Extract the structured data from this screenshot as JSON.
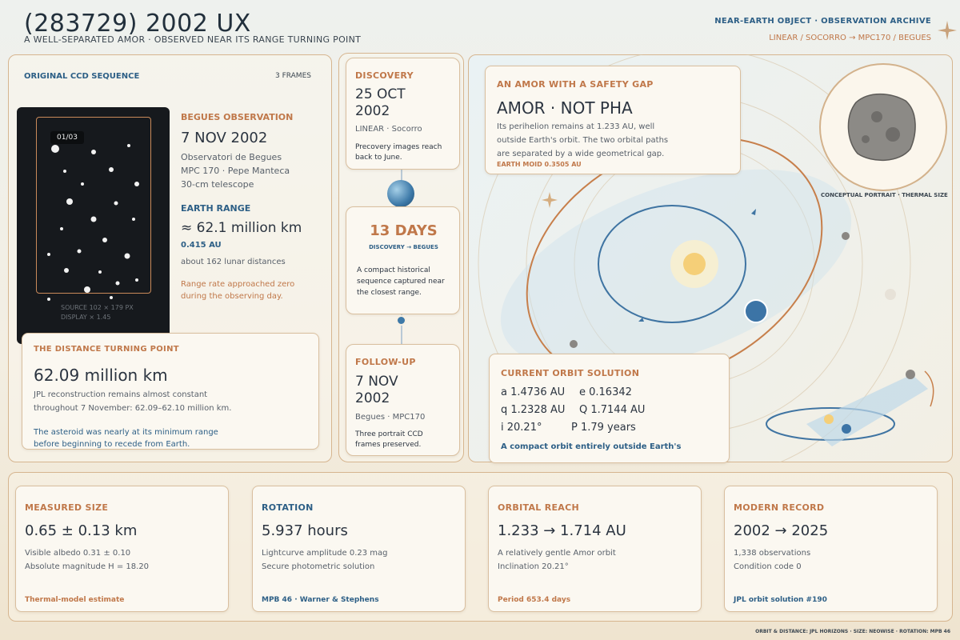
{
  "header": {
    "title": "(283729) 2002 UX",
    "subtitle": "A WELL-SEPARATED AMOR · OBSERVED NEAR ITS RANGE TURNING POINT",
    "archive": "NEAR-EARTH OBJECT · OBSERVATION ARCHIVE",
    "sources": "LINEAR / SOCORRO → MPC170 / BEGUES"
  },
  "ccd": {
    "title": "ORIGINAL CCD SEQUENCE",
    "frames": "3 FRAMES",
    "frame_badge": "01/03",
    "source_line": "SOURCE 102 × 179 PX",
    "display_line": "DISPLAY × 1.45"
  },
  "begues": {
    "kicker": "BEGUES OBSERVATION",
    "date": "7 NOV 2002",
    "line1": "Observatori de Begues",
    "line2": "MPC 170 · Pepe Manteca",
    "line3": "30-cm telescope",
    "range_kicker": "EARTH RANGE",
    "range": "≈ 62.1 million km",
    "range_au": "0.415 AU",
    "lunar": "about 162 lunar distances",
    "note": "Range rate approached zero during the observing day."
  },
  "turning": {
    "kicker": "THE DISTANCE TURNING POINT",
    "value": "62.09 million km",
    "desc": "JPL reconstruction remains almost constant throughout 7 November: 62.09–62.10 million km.",
    "note": "The asteroid was nearly at its minimum range before beginning to recede from Earth."
  },
  "discovery": {
    "kicker": "DISCOVERY",
    "date": "25 OCT 2002",
    "site": "LINEAR · Socorro",
    "note": "Precovery images reach back to June."
  },
  "interval": {
    "days": "13 DAYS",
    "span": "DISCOVERY → BEGUES",
    "note": "A compact historical sequence captured near the closest range."
  },
  "followup": {
    "kicker": "FOLLOW-UP",
    "date": "7 NOV 2002",
    "site": "Begues · MPC170",
    "note": "Three portrait CCD frames preserved."
  },
  "amor": {
    "kicker": "AN AMOR WITH A SAFETY GAP",
    "title": "AMOR · NOT PHA",
    "desc": "Its perihelion remains at 1.233 AU, well outside Earth's orbit. The two orbital paths are separated by a wide geometrical gap.",
    "moid": "EARTH MOID  0.3505 AU"
  },
  "portrait_caption": "CONCEPTUAL PORTRAIT · THERMAL SIZE",
  "orbit": {
    "kicker": "CURRENT ORBIT SOLUTION",
    "a": "a  1.4736 AU",
    "e": "e  0.16342",
    "q": "q  1.2328 AU",
    "Q": "Q  1.7144 AU",
    "i": "i  20.21°",
    "P": "P  1.79 years",
    "note": "A compact orbit entirely outside Earth's"
  },
  "cards": [
    {
      "kicker": "MEASURED SIZE",
      "value": "0.65 ± 0.13 km",
      "line1": "Visible albedo  0.31 ± 0.10",
      "line2": "Absolute magnitude  H = 18.20",
      "foot": "Thermal-model estimate"
    },
    {
      "kicker": "ROTATION",
      "value": "5.937 hours",
      "line1": "Lightcurve amplitude  0.23 mag",
      "line2": "Secure photometric solution",
      "foot": "MPB 46 · Warner & Stephens"
    },
    {
      "kicker": "ORBITAL REACH",
      "value": "1.233 → 1.714 AU",
      "line1": "A relatively gentle Amor orbit",
      "line2": "Inclination  20.21°",
      "foot": "Period  653.4 days"
    },
    {
      "kicker": "MODERN RECORD",
      "value": "2002 → 2025",
      "line1": "1,338 observations",
      "line2": "Condition code 0",
      "foot": "JPL orbit solution #190"
    }
  ],
  "credits": "ORBIT & DISTANCE: JPL HORIZONS · SIZE: NEOWISE · ROTATION: MPB 46",
  "colors": {
    "accent": "#c0784a",
    "blue": "#2d5f86",
    "paper": "#fbf8f1"
  }
}
